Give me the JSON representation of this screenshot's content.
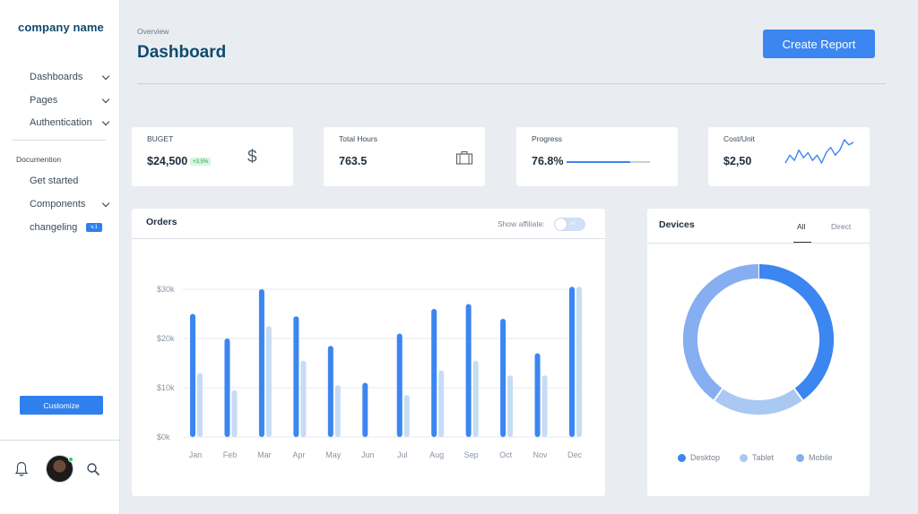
{
  "sidebar": {
    "brand": "company name",
    "nav": [
      {
        "label": "Dashboards"
      },
      {
        "label": "Pages"
      },
      {
        "label": "Authentication"
      }
    ],
    "section_label": "Documention",
    "doc_items": [
      {
        "label": "Get started"
      },
      {
        "label": "Components"
      },
      {
        "label": "changeling",
        "badge": "v.1"
      }
    ],
    "customize_label": "Customize"
  },
  "header": {
    "breadcrumb": "Overview",
    "title": "Dashboard",
    "create_label": "Create Report"
  },
  "stats": {
    "budget": {
      "label": "BUGET",
      "value": "$24,500",
      "delta": "+3.5%"
    },
    "hours": {
      "label": "Total Hours",
      "value": "763.5"
    },
    "progress": {
      "label": "Progress",
      "value": "76.8%",
      "fraction": 0.768
    },
    "cost": {
      "label": "Cost/Unit",
      "value": "$2,50",
      "sparkline": [
        4,
        7,
        5,
        9,
        6,
        8,
        5,
        7,
        4,
        8,
        10,
        7,
        9,
        13,
        11,
        12
      ]
    }
  },
  "orders": {
    "title": "Orders",
    "toggle_label": "Show affiliate:",
    "toggle_text": "on"
  },
  "devices": {
    "title": "Devices",
    "tab_all": "All",
    "tab_direct": "Direct",
    "legend": [
      "Desktop",
      "Tablet",
      "Mobile"
    ]
  },
  "colors": {
    "accent": "#3b86f0",
    "series_primary": "#3b86f0",
    "series_secondary": "#c6dcf5",
    "desktop": "#3b86f0",
    "tablet": "#a9c8f2",
    "mobile": "#86aef0"
  },
  "chart_data": [
    {
      "type": "bar",
      "categories": [
        "Jan",
        "Feb",
        "Mar",
        "Apr",
        "May",
        "Jun",
        "Jul",
        "Aug",
        "Sep",
        "Oct",
        "Nov",
        "Dec"
      ],
      "series": [
        {
          "values": [
            25000,
            20000,
            30000,
            24500,
            18500,
            11000,
            21000,
            26000,
            27000,
            24000,
            17000,
            30500
          ]
        },
        {
          "values": [
            13000,
            9500,
            22500,
            15500,
            10500,
            0,
            8500,
            13500,
            15500,
            12500,
            12500,
            30500
          ]
        }
      ],
      "yticks": [
        "$0k",
        "$10k",
        "$20k",
        "$30k"
      ],
      "ylim": [
        0,
        30000
      ],
      "grid": true
    },
    {
      "type": "pie",
      "labels": [
        "Desktop",
        "Tablet",
        "Mobile"
      ],
      "values": [
        40,
        20,
        40
      ]
    }
  ]
}
